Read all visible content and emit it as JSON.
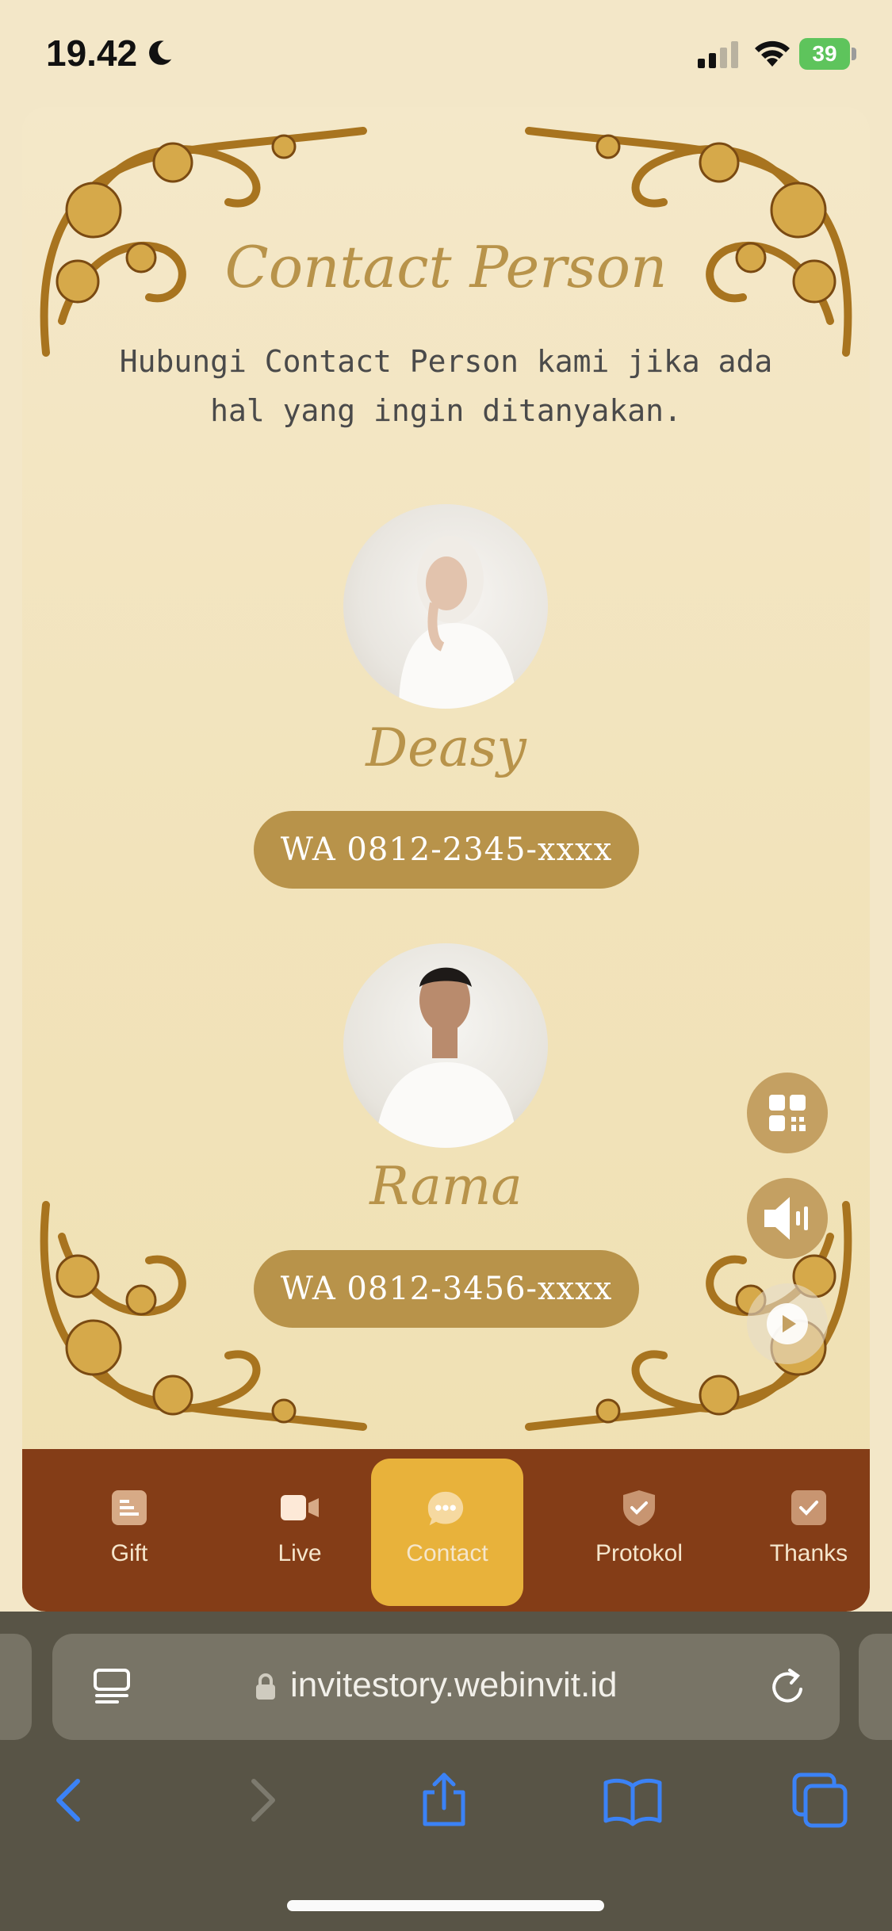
{
  "status": {
    "time": "19.42",
    "battery": "39"
  },
  "card": {
    "title": "Contact Person",
    "subtitle": "Hubungi Contact Person kami jika ada hal yang ingin ditanyakan.",
    "contacts": [
      {
        "name": "Deasy",
        "wa_label": "WA 0812-2345-xxxx"
      },
      {
        "name": "Rama",
        "wa_label": "WA 0812-3456-xxxx"
      }
    ]
  },
  "nav": {
    "items": [
      {
        "label": "Gift"
      },
      {
        "label": "Live"
      },
      {
        "label": "Contact"
      },
      {
        "label": "Protokol"
      },
      {
        "label": "Thanks"
      }
    ],
    "active": "Contact"
  },
  "browser": {
    "url": "invitestory.webinvit.id"
  },
  "colors": {
    "accent": "#b8934a",
    "nav_bg": "#843d17",
    "nav_active": "#e8b23b"
  }
}
